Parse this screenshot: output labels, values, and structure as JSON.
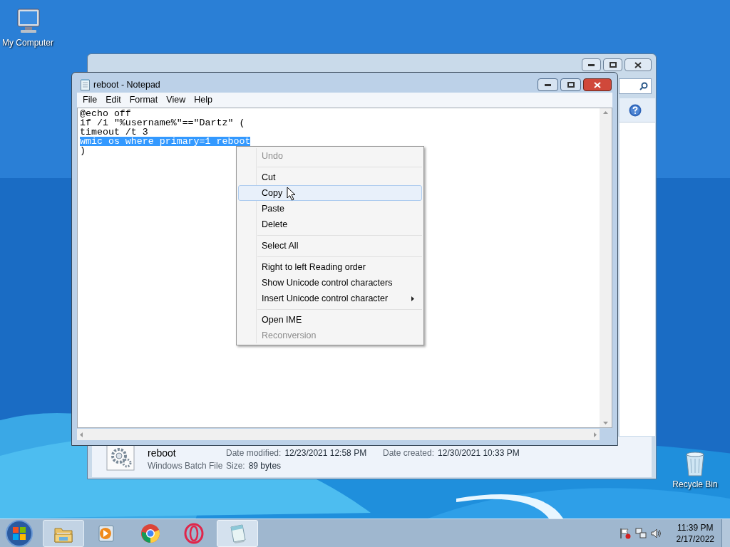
{
  "desktop_icons": [
    {
      "kind": "computer",
      "label": "My Computer"
    },
    {
      "kind": "trash",
      "label": "Recycle Bin"
    }
  ],
  "explorer": {
    "details": {
      "name": "reboot",
      "type": "Windows Batch File",
      "fields": [
        {
          "label": "Date modified:",
          "value": "12/23/2021 12:58 PM"
        },
        {
          "label": "Date created:",
          "value": "12/30/2021 10:33 PM"
        },
        {
          "label": "Size:",
          "value": "89 bytes"
        }
      ]
    }
  },
  "notepad": {
    "title": "reboot - Notepad",
    "menu": [
      "File",
      "Edit",
      "Format",
      "View",
      "Help"
    ],
    "lines": [
      {
        "text": "@echo off",
        "selected": false
      },
      {
        "text": "if /i \"%username%\"==\"Dartz\" (",
        "selected": false
      },
      {
        "text": "timeout /t 3",
        "selected": false
      },
      {
        "text": "wmic os where primary=1 reboot",
        "selected": true
      },
      {
        "text": ")",
        "selected": false
      }
    ]
  },
  "context_menu": [
    {
      "kind": "item",
      "label": "Undo",
      "disabled": true,
      "highlighted": false,
      "submenu": false
    },
    {
      "kind": "separator"
    },
    {
      "kind": "item",
      "label": "Cut",
      "disabled": false,
      "highlighted": false,
      "submenu": false
    },
    {
      "kind": "item",
      "label": "Copy",
      "disabled": false,
      "highlighted": true,
      "submenu": false
    },
    {
      "kind": "item",
      "label": "Paste",
      "disabled": false,
      "highlighted": false,
      "submenu": false
    },
    {
      "kind": "item",
      "label": "Delete",
      "disabled": false,
      "highlighted": false,
      "submenu": false
    },
    {
      "kind": "separator"
    },
    {
      "kind": "item",
      "label": "Select All",
      "disabled": false,
      "highlighted": false,
      "submenu": false
    },
    {
      "kind": "separator"
    },
    {
      "kind": "item",
      "label": "Right to left Reading order",
      "disabled": false,
      "highlighted": false,
      "submenu": false
    },
    {
      "kind": "item",
      "label": "Show Unicode control characters",
      "disabled": false,
      "highlighted": false,
      "submenu": false
    },
    {
      "kind": "item",
      "label": "Insert Unicode control character",
      "disabled": false,
      "highlighted": false,
      "submenu": true
    },
    {
      "kind": "separator"
    },
    {
      "kind": "item",
      "label": "Open IME",
      "disabled": false,
      "highlighted": false,
      "submenu": false
    },
    {
      "kind": "item",
      "label": "Reconversion",
      "disabled": true,
      "highlighted": false,
      "submenu": false
    }
  ],
  "taskbar": {
    "apps": [
      {
        "kind": "folder",
        "active": false
      },
      {
        "kind": "media",
        "active": false
      },
      {
        "kind": "chrome",
        "active": false
      },
      {
        "kind": "opera",
        "active": false
      },
      {
        "kind": "notepad",
        "active": true
      }
    ],
    "clock": {
      "time": "11:39 PM",
      "date": "2/17/2022"
    }
  }
}
